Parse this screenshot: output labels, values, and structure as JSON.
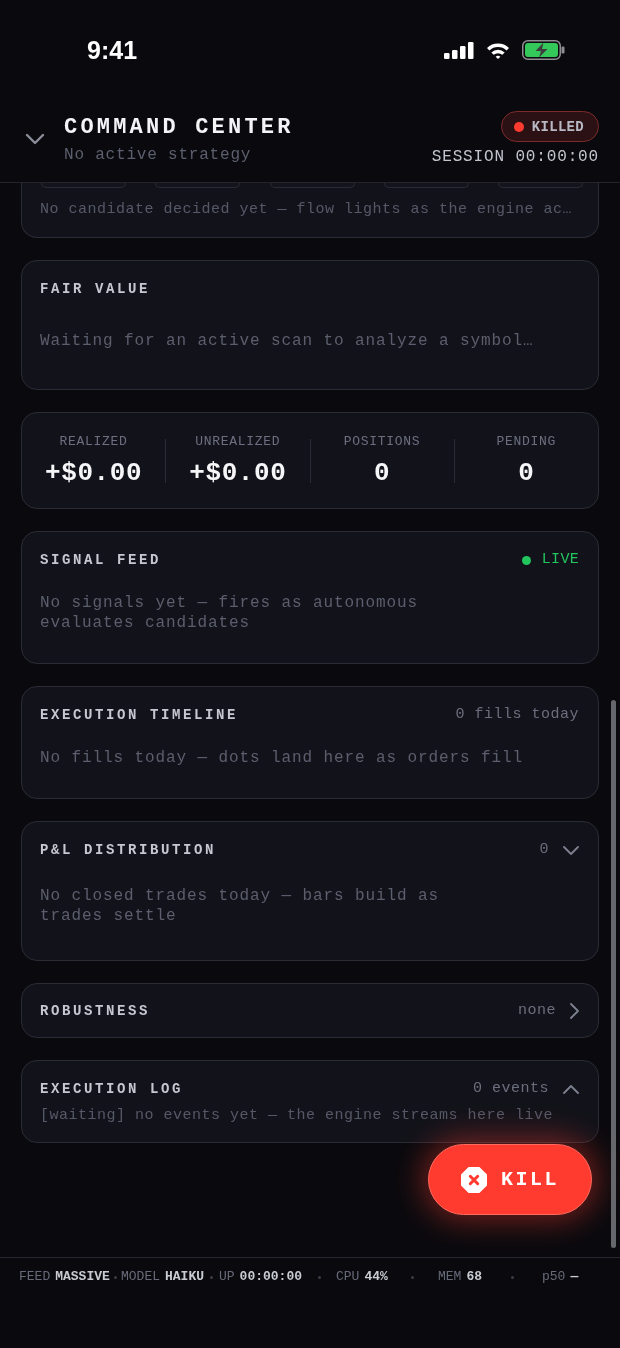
{
  "status_bar": {
    "time": "9:41"
  },
  "header": {
    "title": "COMMAND CENTER",
    "subtitle": "No active strategy",
    "badge": {
      "label": "KILLED",
      "kind": "danger"
    },
    "session": "SESSION 00:00:00"
  },
  "cards": [
    {
      "kind": "pipeline",
      "message": "No candidate decided yet — flow lights as the engine ac…"
    },
    {
      "kind": "note",
      "title": "FAIR VALUE",
      "message": "Waiting for an active scan to analyze a symbol…"
    },
    {
      "kind": "stats",
      "stats": [
        {
          "label": "REALIZED",
          "value": "+$0.00"
        },
        {
          "label": "UNREALIZED",
          "value": "+$0.00"
        },
        {
          "label": "POSITIONS",
          "value": "0"
        },
        {
          "label": "PENDING",
          "value": "0"
        }
      ]
    },
    {
      "kind": "note",
      "title": "SIGNAL FEED",
      "badge": {
        "label": "LIVE",
        "kind": "live"
      },
      "message": "No signals yet — fires as autonomous evaluates candidates"
    },
    {
      "kind": "note",
      "title": "EXECUTION TIMELINE",
      "meta": "0 fills today",
      "message": "No fills today — dots land here as orders fill"
    },
    {
      "kind": "note",
      "title": "P&L DISTRIBUTION",
      "meta": "0",
      "toggle": {
        "kind": "down"
      },
      "message": "No closed trades today — bars build as trades settle"
    },
    {
      "kind": "row",
      "title": "ROBUSTNESS",
      "meta": "none",
      "toggle": {
        "kind": "right"
      }
    },
    {
      "kind": "log",
      "title": "EXECUTION LOG",
      "meta": "0 events",
      "toggle": {
        "kind": "up"
      },
      "message": "[waiting] no events yet — the engine streams here live"
    }
  ],
  "kill_button": {
    "label": "KILL"
  },
  "footer": [
    {
      "label": "FEED",
      "value": "MASSIVE"
    },
    {
      "label": "MODEL",
      "value": "HAIKU"
    },
    {
      "label": "UP",
      "value": "00:00:00"
    },
    {
      "label": "CPU",
      "value": "44%"
    },
    {
      "label": "MEM",
      "value": "68"
    },
    {
      "label": "p50",
      "value": "—"
    }
  ]
}
